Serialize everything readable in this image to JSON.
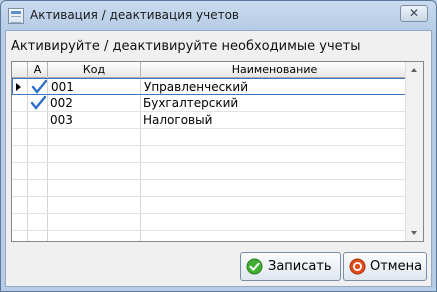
{
  "window": {
    "title": "Активация / деактивация учетов",
    "close_glyph": "✕"
  },
  "heading": "Активируйте / деактивируйте необходимые учеты",
  "grid": {
    "columns": {
      "active": "А",
      "code": "Код",
      "name": "Наименование"
    },
    "rows": [
      {
        "checked": true,
        "code": "001",
        "name": "Управленческий",
        "selected": true
      },
      {
        "checked": true,
        "code": "002",
        "name": "Бухгалтерский",
        "selected": false
      },
      {
        "checked": false,
        "code": "003",
        "name": "Налоговый",
        "selected": false
      }
    ]
  },
  "buttons": {
    "save": "Записать",
    "cancel": "Отмена"
  },
  "colors": {
    "check": "#2f6fc9",
    "save_icon": "#3fae32",
    "cancel_icon": "#e24b1a"
  }
}
